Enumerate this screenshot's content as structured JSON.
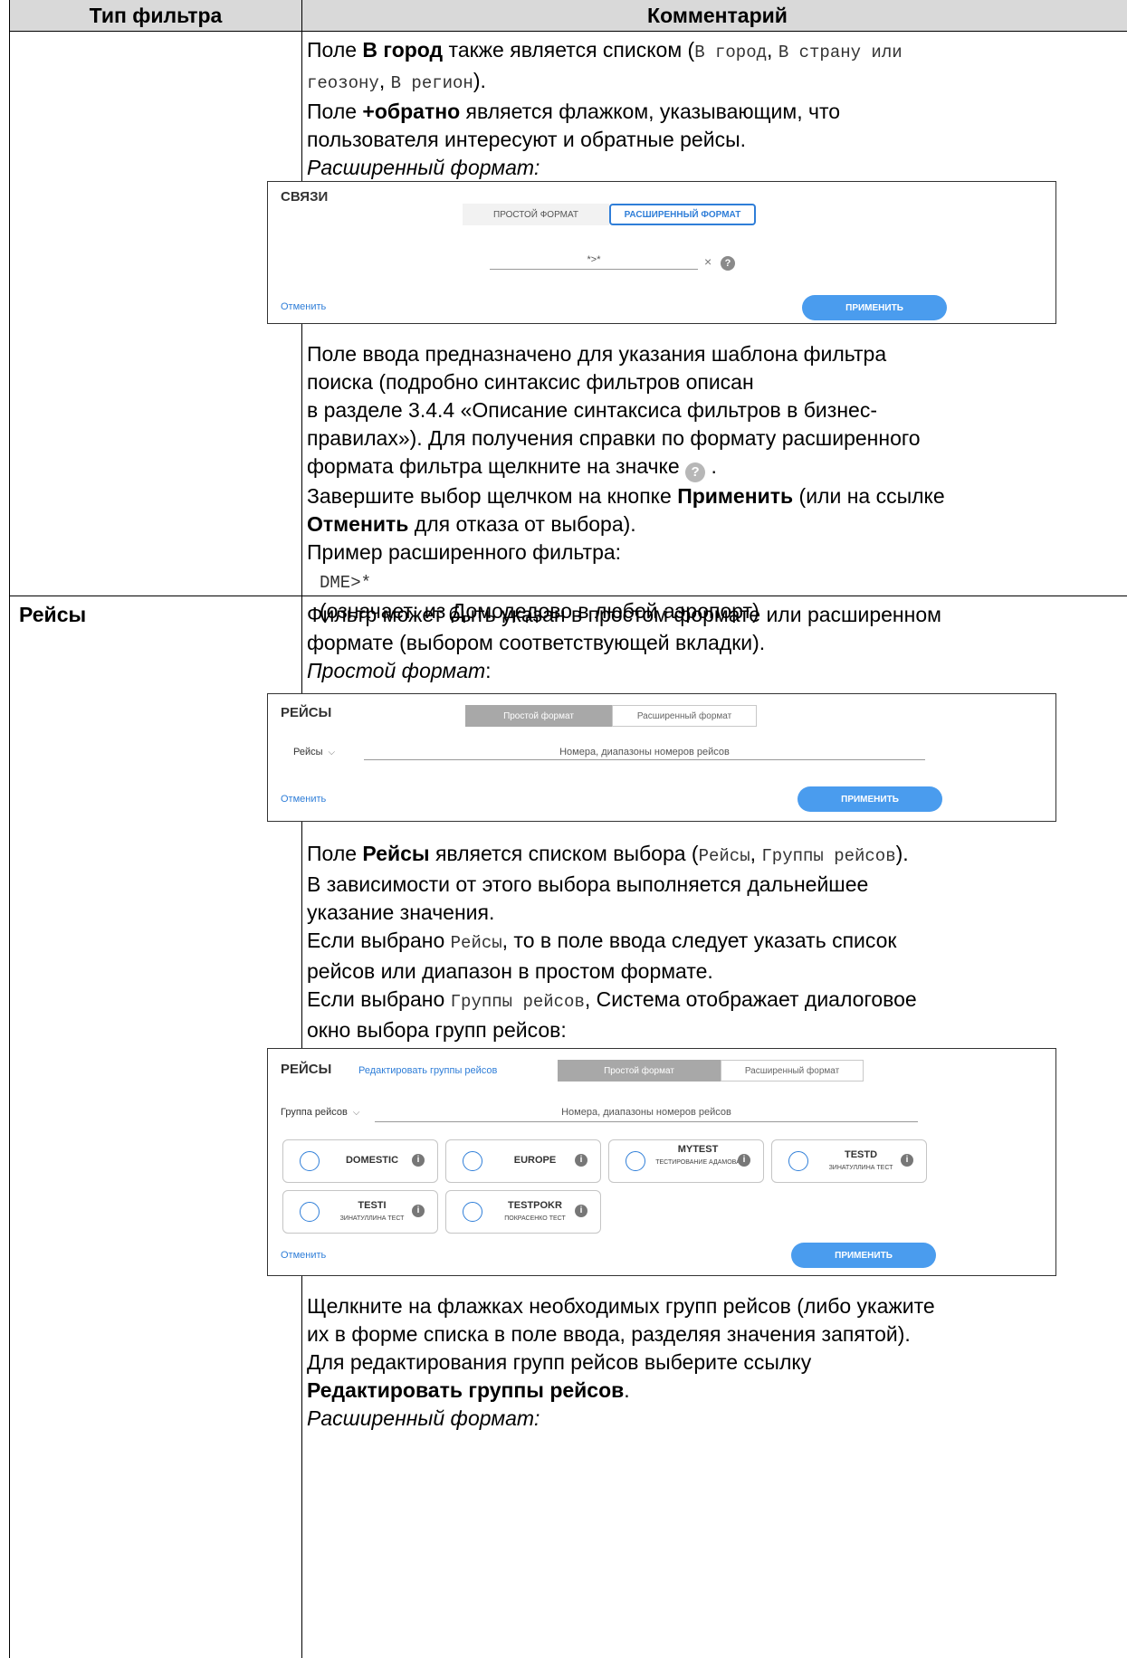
{
  "table": {
    "header": {
      "col1": "Тип фильтра",
      "col2": "Комментарий"
    }
  },
  "row1": {
    "p1_a": "Поле ",
    "p1_b": "В город",
    "p1_c": " также является списком (",
    "p1_mono1": "В город",
    "p1_d": ", ",
    "p1_mono2": "В страну или",
    "p2_mono": "геозону",
    "p2_a": ", ",
    "p2_mono2": "В регион",
    "p2_b": ").",
    "p3_a": "Поле ",
    "p3_b": "+обратно",
    "p3_c": " является флажком, указывающим, что",
    "p4": "пользователя интересуют и обратные рейсы.",
    "p5": "Расширенный формат:",
    "shot": {
      "title": "СВЯЗИ",
      "tab_simple": "ПРОСТОЙ ФОРМАТ",
      "tab_ext": "РАСШИРЕННЫЙ ФОРМАТ",
      "input_value": "*>*",
      "clear": "×",
      "help": "?",
      "cancel": "Отменить",
      "apply": "ПРИМЕНИТЬ"
    },
    "p6": "Поле ввода предназначено для указания шаблона фильтра",
    "p7": "поиска (подробно синтаксис фильтров описан",
    "p8": "в разделе 3.4.4 «Описание синтаксиса фильтров в бизнес-",
    "p9": "правилах»). Для получения справки по формату расширенного",
    "p10": "формата фильтра щелкните на значке",
    "p10_icon": "?",
    "p10_end": ".",
    "p11_a": "Завершите выбор щелчком на кнопке ",
    "p11_b": "Применить",
    "p11_c": " (или на ссылке",
    "p12_a": "Отменить",
    "p12_b": " для отказа от выбора).",
    "p13": "Пример расширенного фильтра:",
    "p14": "DME>*",
    "p15": "(означает: из Домодедово в любой аэропорт)"
  },
  "row2": {
    "type": "Рейсы",
    "p1": "Фильтр может быть указан в простом формате или расширенном",
    "p2": "формате (выбором соответствующей вкладки).",
    "p3": "Простой формат",
    "p3_colon": ":",
    "shot1": {
      "title": "РЕЙСЫ",
      "tab_simple": "Простой формат",
      "tab_ext": "Расширенный формат",
      "dropdown": "Рейсы",
      "chev": "⌵",
      "placeholder": "Номера, диапазоны номеров рейсов",
      "cancel": "Отменить",
      "apply": "ПРИМЕНИТЬ"
    },
    "p4_a": "Поле ",
    "p4_b": "Рейсы",
    "p4_c": " является списком выбора (",
    "p4_mono1": "Рейсы",
    "p4_d": ", ",
    "p4_mono2": "Группы рейсов",
    "p4_e": ").",
    "p5": "В зависимости от этого выбора выполняется дальнейшее",
    "p6": "указание значения.",
    "p7_a": "Если выбрано ",
    "p7_mono": "Рейсы",
    "p7_b": ", то в поле ввода следует указать список",
    "p8": "рейсов или диапазон в простом формате.",
    "p9_a": "Если выбрано ",
    "p9_mono": "Группы рейсов",
    "p9_b": ", Система отображает диалоговое",
    "p10": "окно выбора групп рейсов:",
    "shot2": {
      "title": "РЕЙСЫ",
      "edit_link": "Редактировать группы рейсов",
      "tab_simple": "Простой формат",
      "tab_ext": "Расширенный формат",
      "dropdown": "Группа рейсов",
      "chev": "⌵",
      "placeholder": "Номера, диапазоны номеров рейсов",
      "chips": [
        {
          "name": "DOMESTIC",
          "sub": ""
        },
        {
          "name": "EUROPE",
          "sub": ""
        },
        {
          "name": "MYTEST",
          "sub": "ТЕСТИРОВАНИЕ АДАМОВА"
        },
        {
          "name": "TESTD",
          "sub": "ЗИНАТУЛЛИНА ТЕСТ"
        },
        {
          "name": "TESTI",
          "sub": "ЗИНАТУЛЛИНА ТЕСТ"
        },
        {
          "name": "TESTPOKR",
          "sub": "ПОКРАСЕНКО ТЕСТ"
        }
      ],
      "info": "i",
      "cancel": "Отменить",
      "apply": "ПРИМЕНИТЬ"
    },
    "p11": "Щелкните на флажках необходимых групп рейсов (либо укажите",
    "p12": "их в форме списка в поле ввода, разделяя значения запятой).",
    "p13": "Для редактирования групп рейсов выберите ссылку",
    "p14_a": "Редактировать группы рейсов",
    "p14_b": ".",
    "p15": "Расширенный формат:"
  }
}
